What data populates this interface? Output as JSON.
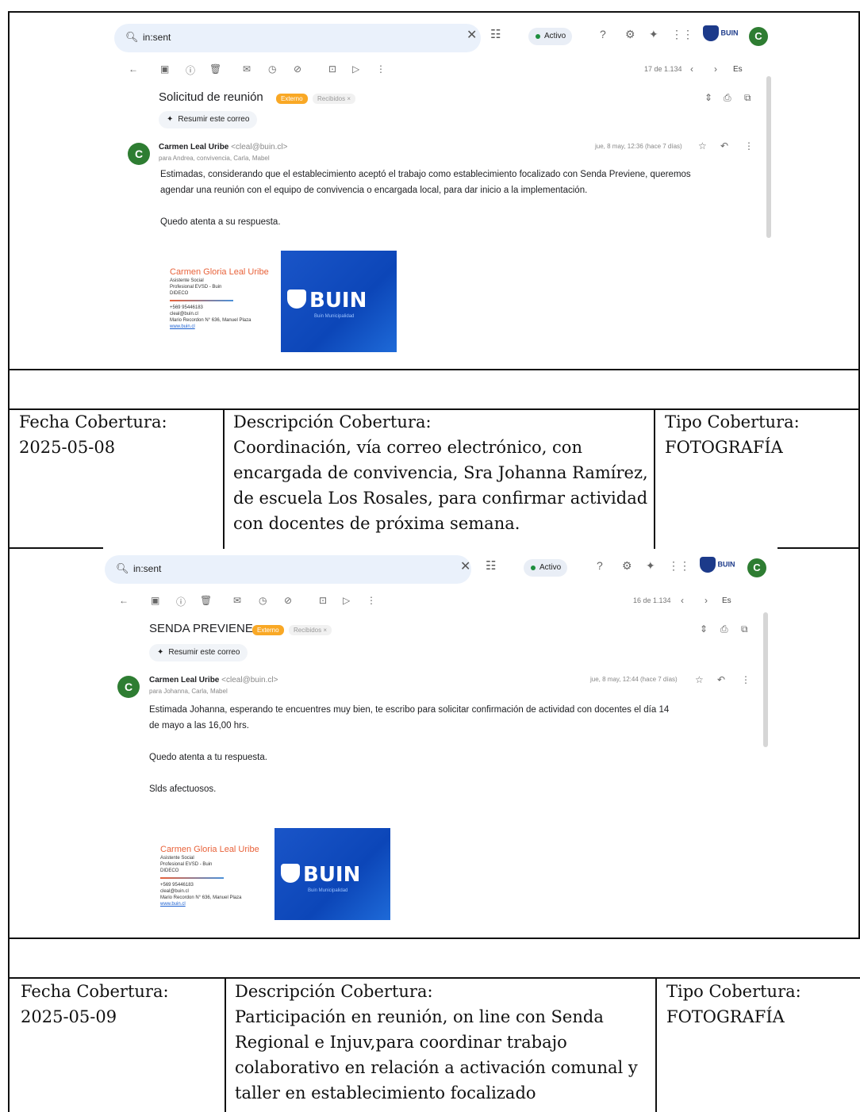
{
  "email1": {
    "search_text": "in:sent",
    "status": "Activo",
    "brand": "BUIN",
    "avatar_letter": "C",
    "pager": "17 de 1.134",
    "lang": "Es",
    "subject": "Solicitud de reunión",
    "tag_external": "Externo",
    "tag_inbox": "Recibidos ×",
    "summarize": "Resumir este correo",
    "sender_name": "Carmen Leal Uribe",
    "sender_email": "<cleal@buin.cl>",
    "recipients": "para Andrea, convivencia, Carla, Mabel",
    "date": "jue, 8 may, 12:36 (hace 7 días)",
    "body_lines": [
      "Estimadas, considerando que el establecimiento aceptó el trabajo como establecimiento focalizado con Senda Previene, queremos",
      "agendar una reunión con el equipo de convivencia o encargada local, para dar inicio a la implementación."
    ],
    "closing": "Quedo atenta a  su respuesta."
  },
  "email2": {
    "search_text": "in:sent",
    "status": "Activo",
    "brand": "BUIN",
    "avatar_letter": "C",
    "pager": "16 de 1.134",
    "lang": "Es",
    "subject": "SENDA PREVIENE",
    "tag_external": "Externo",
    "tag_inbox": "Recibidos ×",
    "summarize": "Resumir este correo",
    "sender_name": "Carmen Leal Uribe",
    "sender_email": "<cleal@buin.cl>",
    "recipients": "para Johanna, Carla, Mabel",
    "date": "jue, 8 may, 12:44 (hace 7 días)",
    "body_lines": [
      "Estimada Johanna, esperando te encuentres muy bien, te escribo para solicitar confirmación de  actividad con docentes el día 14",
      "de mayo a las 16,00 hrs."
    ],
    "closing": "Quedo atenta a tu respuesta.",
    "farewell": "Slds afectuosos."
  },
  "signature": {
    "name": "Carmen Gloria Leal Uribe",
    "role1": "Asistente Social",
    "role2": "Profesional EVSD - Buin",
    "role3": "DIDECO",
    "phone": "+569 95446183",
    "email": "cleal@buin.cl",
    "address": "Mario Recordon N° 636, Manuel Plaza",
    "web": "www.buin.cl",
    "card_logo": "BUIN",
    "card_sub": "Buin Municipalidad"
  },
  "row1": {
    "fecha_label": "Fecha Cobertura:",
    "fecha_value": "2025-05-08",
    "desc_label": "Descripción Cobertura:",
    "desc_lines": [
      "Coordinación, vía correo electrónico, con",
      "encargada de convivencia, Sra Johanna Ramírez,",
      "de escuela Los Rosales, para confirmar actividad",
      "con docentes de próxima semana."
    ],
    "tipo_label": "Tipo Cobertura:",
    "tipo_value": "FOTOGRAFÍA"
  },
  "row2": {
    "fecha_label": "Fecha Cobertura:",
    "fecha_value": "2025-05-09",
    "desc_label": "Descripción Cobertura:",
    "desc_lines": [
      "Participación en reunión, on line con Senda",
      "Regional  e Injuv,para coordinar trabajo",
      "colaborativo en relación a activación comunal y",
      "taller en establecimiento focalizado"
    ],
    "tipo_label": "Tipo Cobertura:",
    "tipo_value": "FOTOGRAFÍA"
  }
}
